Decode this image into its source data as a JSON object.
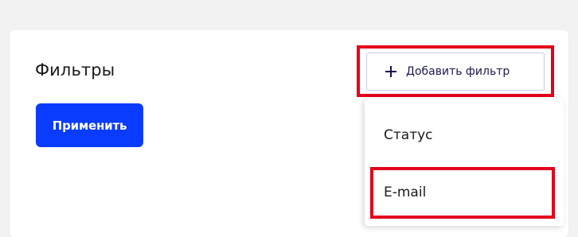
{
  "filters": {
    "title": "Фильтры",
    "apply_label": "Применить",
    "add_filter_label": "Добавить фильтр"
  },
  "dropdown": {
    "items": [
      {
        "label": "Статус"
      },
      {
        "label": "E-mail"
      }
    ]
  },
  "colors": {
    "primary": "#0a3cff",
    "highlight": "#e3001b",
    "background": "#f2f2f2"
  }
}
